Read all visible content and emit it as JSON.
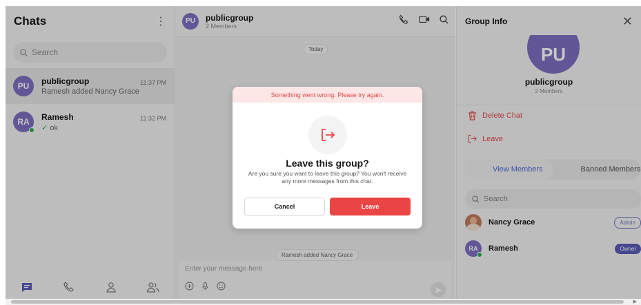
{
  "sidebar": {
    "title": "Chats",
    "menu_icon": "kebab-icon",
    "search_placeholder": "Search",
    "conversations": [
      {
        "initials": "PU",
        "name": "publicgroup",
        "last_message": "Ramesh added Nancy Grace",
        "time": "11:37 PM",
        "active": true,
        "online": false
      },
      {
        "initials": "RA",
        "name": "Ramesh",
        "last_message": "ok",
        "time": "11:32 PM",
        "active": false,
        "online": true
      }
    ],
    "nav_icons": [
      "chats-icon",
      "calls-icon",
      "users-icon",
      "groups-icon"
    ]
  },
  "chat": {
    "initials": "PU",
    "name": "publicgroup",
    "members": "2 Members",
    "date_chip": "Today",
    "system_message": "Ramesh added Nancy Grace",
    "composer_placeholder": "Enter your message here"
  },
  "group_info": {
    "title": "Group Info",
    "avatar_initials": "PU",
    "group_name": "publicgroup",
    "members": "2 Members",
    "delete_label": "Delete Chat",
    "leave_label": "Leave",
    "tabs": [
      "View Members",
      "Banned Members"
    ],
    "search_placeholder": "Search",
    "member_list": [
      {
        "name": "Nancy Grace",
        "role": "Admin"
      },
      {
        "initials": "RA",
        "name": "Ramesh",
        "role": "Owner"
      }
    ]
  },
  "modal": {
    "error": "Something went wrong. Please try again.",
    "title": "Leave this group?",
    "description": "Are you sure you want to leave this group? You won't receive any more messages from this chat.",
    "cancel_label": "Cancel",
    "confirm_label": "Leave"
  },
  "colors": {
    "accent": "#7e6fc1",
    "danger": "#ea4545",
    "online": "#2fa84f",
    "owner_badge": "#5a5bb8"
  }
}
